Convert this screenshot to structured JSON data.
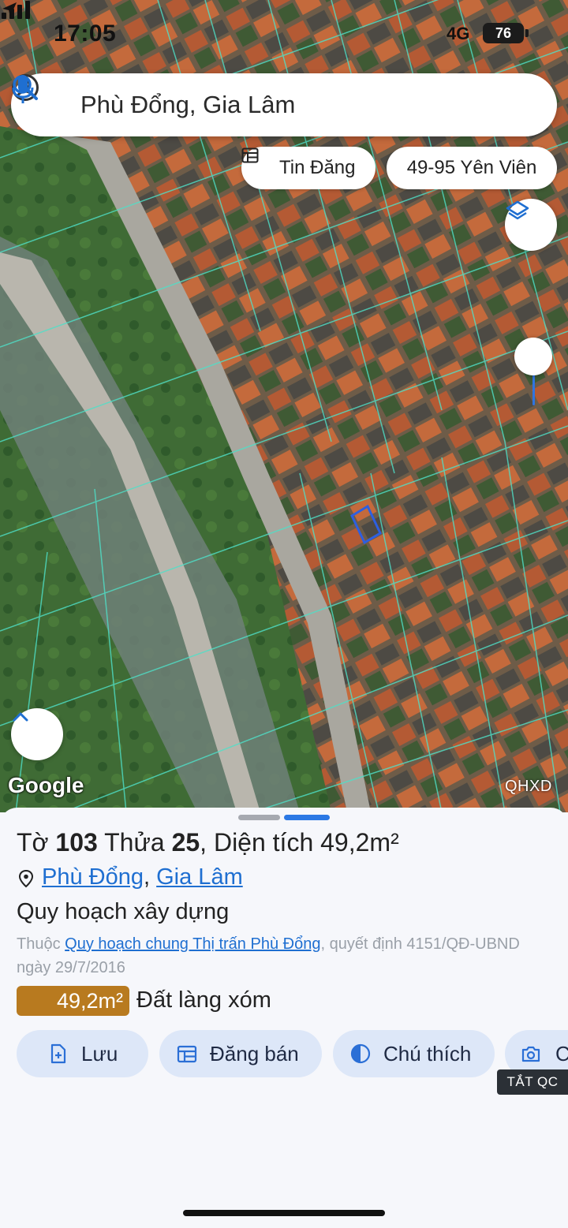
{
  "status": {
    "time": "17:05",
    "network": "4G",
    "battery": "76"
  },
  "search": {
    "query": "Phù Đổng, Gia Lâm"
  },
  "chips": {
    "listing": "Tin Đăng",
    "address": "49-95 Yên Viên"
  },
  "map": {
    "attribution": "Google",
    "layer_label": "QHXD"
  },
  "parcel": {
    "sheet_prefix": "Tờ",
    "sheet_no": "103",
    "plot_prefix": "Thửa",
    "plot_no": "25",
    "area_prefix": ", Diện tích",
    "area": "49,2m²",
    "ward": "Phù Đổng",
    "district": "Gia Lâm",
    "plan_type": "Quy hoạch xây dựng",
    "plan_desc_prefix": "Thuộc",
    "plan_name": "Quy hoạch chung Thị trấn Phù Đổng",
    "plan_desc_suffix": ", quyết định 4151/QĐ-UBND ngày 29/7/2016",
    "land_area_badge": "49,2m²",
    "land_use": "Đất làng xóm"
  },
  "actions": {
    "save": "Lưu",
    "sell": "Đăng bán",
    "legend": "Chú thích",
    "screenshot": "C"
  },
  "ads_off": "TẮT QC",
  "colors": {
    "accent": "#1f6fd1",
    "badge": "#b87a1f",
    "chip_bg": "#dde7f8",
    "parcel_line": "#4fe0c8"
  }
}
